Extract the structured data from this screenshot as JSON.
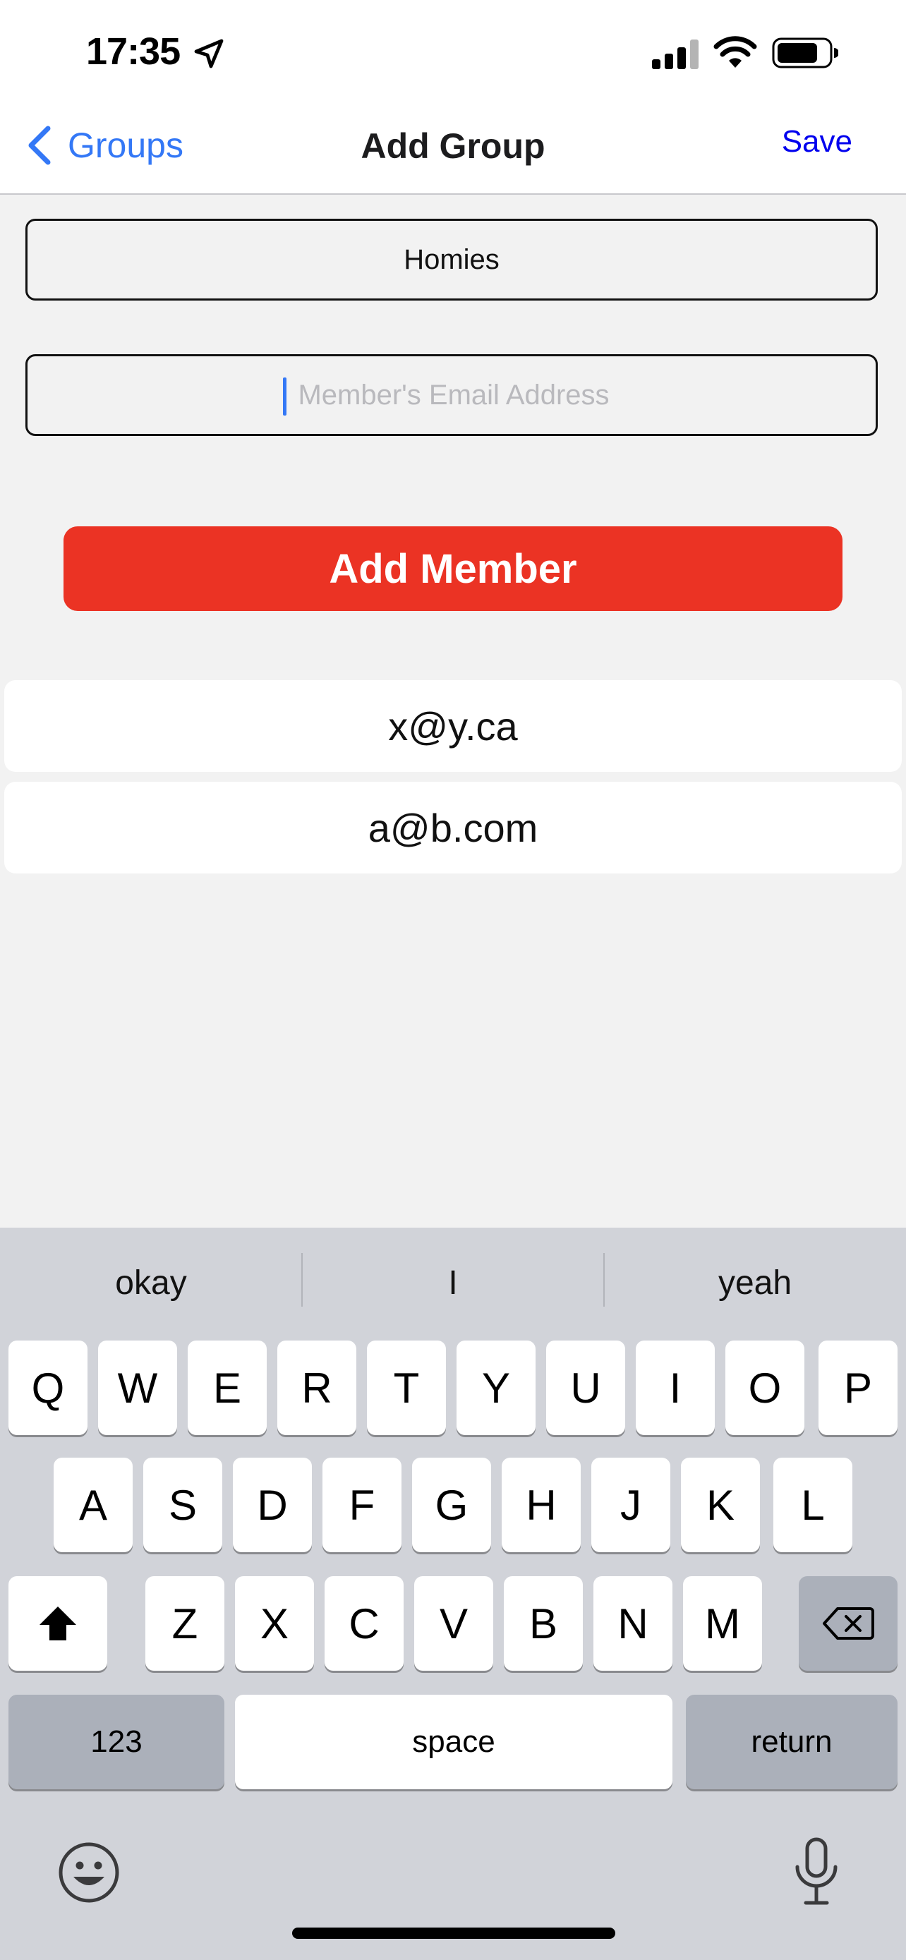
{
  "status_bar": {
    "time": "17:35"
  },
  "nav": {
    "back_label": "Groups",
    "title": "Add Group",
    "save_label": "Save"
  },
  "form": {
    "group_name_value": "Homies",
    "email_placeholder": "Member's Email Address",
    "email_value": "",
    "add_member_label": "Add Member"
  },
  "members": [
    "x@y.ca",
    "a@b.com"
  ],
  "keyboard": {
    "suggestions": [
      "okay",
      "I",
      "yeah"
    ],
    "row1": [
      "Q",
      "W",
      "E",
      "R",
      "T",
      "Y",
      "U",
      "I",
      "O",
      "P"
    ],
    "row2": [
      "A",
      "S",
      "D",
      "F",
      "G",
      "H",
      "J",
      "K",
      "L"
    ],
    "row3": [
      "Z",
      "X",
      "C",
      "V",
      "B",
      "N",
      "M"
    ],
    "numbers_label": "123",
    "space_label": "space",
    "return_label": "return"
  },
  "colors": {
    "accent_blue": "#3478f6",
    "save_blue": "#0000ee",
    "button_red": "#eb3324",
    "background": "#f2f2f2",
    "keyboard_bg": "#d1d3d9"
  },
  "icons": {
    "location": "location-arrow-icon",
    "signal": "cellular-signal-icon",
    "wifi": "wifi-icon",
    "battery": "battery-icon",
    "back": "chevron-left-icon",
    "shift": "shift-icon",
    "delete": "delete-backspace-icon",
    "emoji": "emoji-icon",
    "mic": "microphone-icon"
  }
}
